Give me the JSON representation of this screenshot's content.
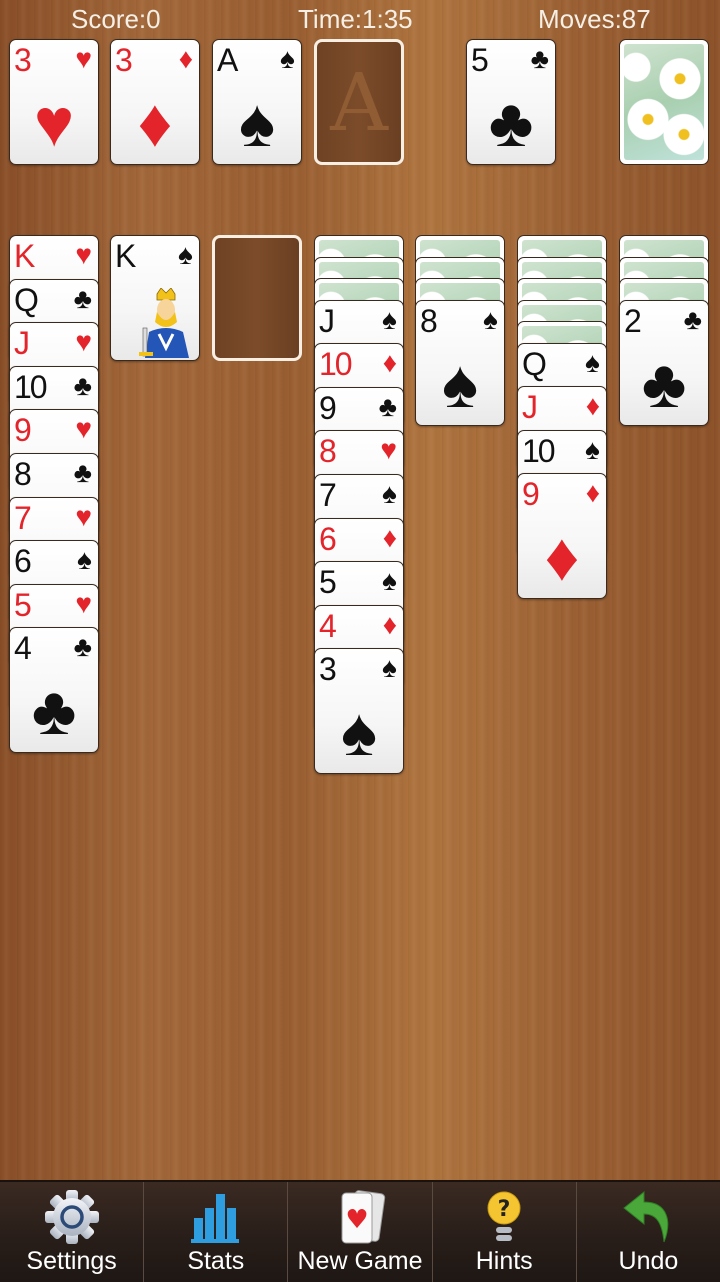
{
  "hud": {
    "score": "Score:0",
    "time": "Time:1:35",
    "moves": "Moves:87"
  },
  "foundations": [
    {
      "rank": "3",
      "suit": "♥",
      "color": "red"
    },
    {
      "rank": "3",
      "suit": "♦",
      "color": "red"
    },
    {
      "rank": "A",
      "suit": "♠",
      "color": "black"
    },
    {
      "empty": true,
      "placeholder": "A"
    }
  ],
  "waste": {
    "rank": "5",
    "suit": "♣",
    "color": "black"
  },
  "stock": {
    "face_down": true
  },
  "tableau": [
    {
      "face_down": 0,
      "cards": [
        {
          "rank": "K",
          "suit": "♥",
          "color": "red"
        },
        {
          "rank": "Q",
          "suit": "♣",
          "color": "black"
        },
        {
          "rank": "J",
          "suit": "♥",
          "color": "red"
        },
        {
          "rank": "10",
          "suit": "♣",
          "color": "black"
        },
        {
          "rank": "9",
          "suit": "♥",
          "color": "red"
        },
        {
          "rank": "8",
          "suit": "♣",
          "color": "black"
        },
        {
          "rank": "7",
          "suit": "♥",
          "color": "red"
        },
        {
          "rank": "6",
          "suit": "♠",
          "color": "black"
        },
        {
          "rank": "5",
          "suit": "♥",
          "color": "red"
        },
        {
          "rank": "4",
          "suit": "♣",
          "color": "black"
        }
      ]
    },
    {
      "face_down": 0,
      "cards": [
        {
          "rank": "K",
          "suit": "♠",
          "color": "black",
          "face": "king"
        }
      ]
    },
    {
      "face_down": 0,
      "cards": [],
      "empty": true
    },
    {
      "face_down": 3,
      "cards": [
        {
          "rank": "J",
          "suit": "♠",
          "color": "black"
        },
        {
          "rank": "10",
          "suit": "♦",
          "color": "red"
        },
        {
          "rank": "9",
          "suit": "♣",
          "color": "black"
        },
        {
          "rank": "8",
          "suit": "♥",
          "color": "red"
        },
        {
          "rank": "7",
          "suit": "♠",
          "color": "black"
        },
        {
          "rank": "6",
          "suit": "♦",
          "color": "red"
        },
        {
          "rank": "5",
          "suit": "♠",
          "color": "black"
        },
        {
          "rank": "4",
          "suit": "♦",
          "color": "red"
        },
        {
          "rank": "3",
          "suit": "♠",
          "color": "black"
        }
      ]
    },
    {
      "face_down": 3,
      "cards": [
        {
          "rank": "8",
          "suit": "♠",
          "color": "black"
        }
      ]
    },
    {
      "face_down": 5,
      "cards": [
        {
          "rank": "Q",
          "suit": "♠",
          "color": "black"
        },
        {
          "rank": "J",
          "suit": "♦",
          "color": "red"
        },
        {
          "rank": "10",
          "suit": "♠",
          "color": "black"
        },
        {
          "rank": "9",
          "suit": "♦",
          "color": "red"
        }
      ]
    },
    {
      "face_down": 3,
      "cards": [
        {
          "rank": "2",
          "suit": "♣",
          "color": "black"
        }
      ]
    }
  ],
  "toolbar": [
    {
      "label": "Settings",
      "icon": "gear-icon"
    },
    {
      "label": "Stats",
      "icon": "bar-chart-icon"
    },
    {
      "label": "New Game",
      "icon": "new-game-cards-icon"
    },
    {
      "label": "Hints",
      "icon": "lightbulb-question-icon"
    },
    {
      "label": "Undo",
      "icon": "undo-arrow-icon"
    }
  ],
  "colors": {
    "card_red": "#e3242b",
    "card_black": "#111111",
    "felt_wood": "#9c6134",
    "toolbar_bg": "#2a1f1a",
    "stats_blue": "#2f9ee0",
    "undo_green": "#4aa83a",
    "hint_yellow": "#f4c531"
  }
}
